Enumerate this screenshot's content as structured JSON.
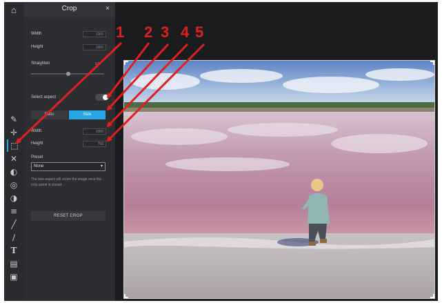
{
  "toolstrip": {
    "tools": [
      {
        "icon": "file-edit-icon",
        "glyph": "✎",
        "active": false
      },
      {
        "icon": "move-icon",
        "glyph": "✛",
        "active": false
      },
      {
        "icon": "crop-icon",
        "glyph": "⬚",
        "active": true
      },
      {
        "icon": "cut-icon",
        "glyph": "✕",
        "active": false
      },
      {
        "icon": "adjust-icon",
        "glyph": "◐",
        "active": false
      },
      {
        "icon": "filter-icon",
        "glyph": "◎",
        "active": false
      },
      {
        "icon": "vignette-icon",
        "glyph": "◑",
        "active": false
      },
      {
        "icon": "layers-icon",
        "glyph": "≡",
        "active": false
      },
      {
        "icon": "brush-icon",
        "glyph": "╱",
        "active": false
      },
      {
        "icon": "draw-icon",
        "glyph": "∕",
        "active": false
      },
      {
        "icon": "text-icon",
        "glyph": "T",
        "active": false
      },
      {
        "icon": "frame-icon",
        "glyph": "▤",
        "active": false
      },
      {
        "icon": "image-icon",
        "glyph": "▣",
        "active": false
      }
    ]
  },
  "panel": {
    "title": "Crop",
    "close": "×",
    "width_label": "Width",
    "width_value": "1000",
    "height_label": "Height",
    "height_value": "1000",
    "straighten_label": "Straighten",
    "straighten_value": "0.0°",
    "select_aspect_label": "Select aspect",
    "select_aspect_on": true,
    "tabs": [
      "Ratio",
      "Size"
    ],
    "active_tab": "Size",
    "size_width_label": "Width",
    "size_width_value": "1000",
    "size_height_label": "Height",
    "size_height_value": "750",
    "preset_label": "Preset",
    "preset_value": "None",
    "note": "The size aspect will resize the image once the crop panel is closed.",
    "reset_button": "RESET CROP"
  },
  "annotations": {
    "labels": [
      "1",
      "2",
      "3",
      "4",
      "5"
    ],
    "color": "#e02020"
  },
  "colors": {
    "accent": "#27a6e5",
    "panel_bg": "#2d2e31",
    "app_bg": "#1b1c1e"
  }
}
